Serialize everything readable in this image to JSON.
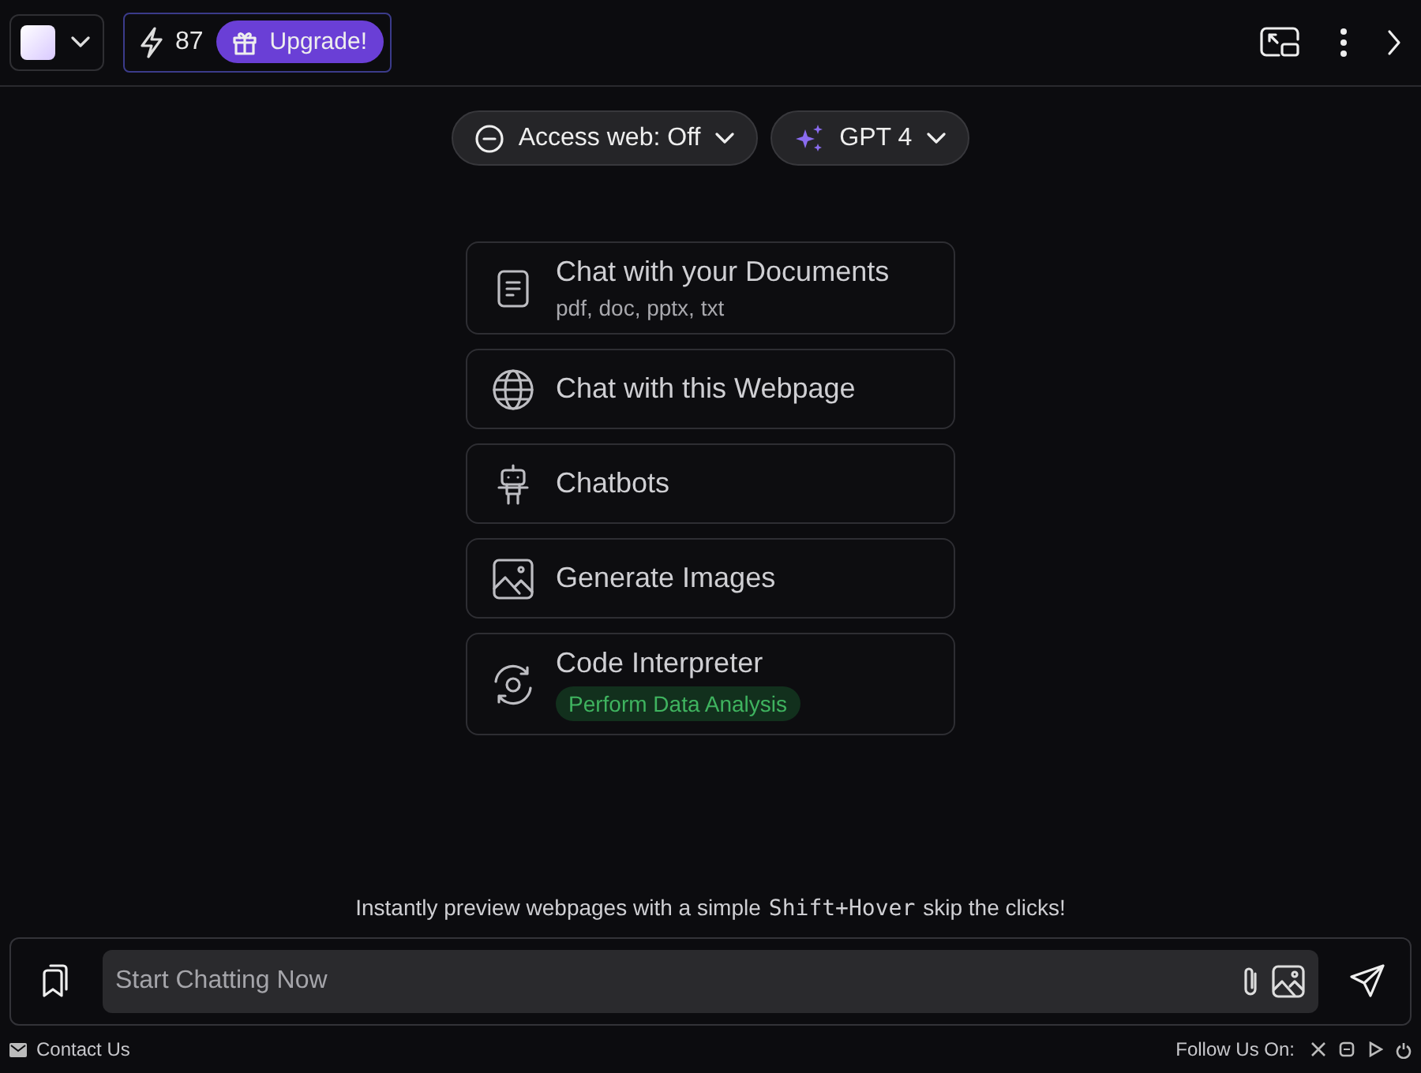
{
  "topbar": {
    "credits": "87",
    "upgrade": "Upgrade!"
  },
  "pills": [
    {
      "label": "Access web: Off"
    },
    {
      "label": "GPT 4"
    }
  ],
  "features": [
    {
      "title": "Chat with your Documents",
      "subtitle": "pdf, doc, pptx, txt"
    },
    {
      "title": "Chat with this Webpage"
    },
    {
      "title": "Chatbots"
    },
    {
      "title": "Generate Images"
    },
    {
      "title": "Code Interpreter",
      "badge": "Perform Data Analysis"
    }
  ],
  "hint": {
    "before": "Instantly preview webpages with a simple",
    "key": "Shift+Hover",
    "after": "skip the clicks!"
  },
  "chat": {
    "placeholder": "Start Chatting Now"
  },
  "footer": {
    "contact": "Contact Us",
    "follow": "Follow Us On:"
  }
}
